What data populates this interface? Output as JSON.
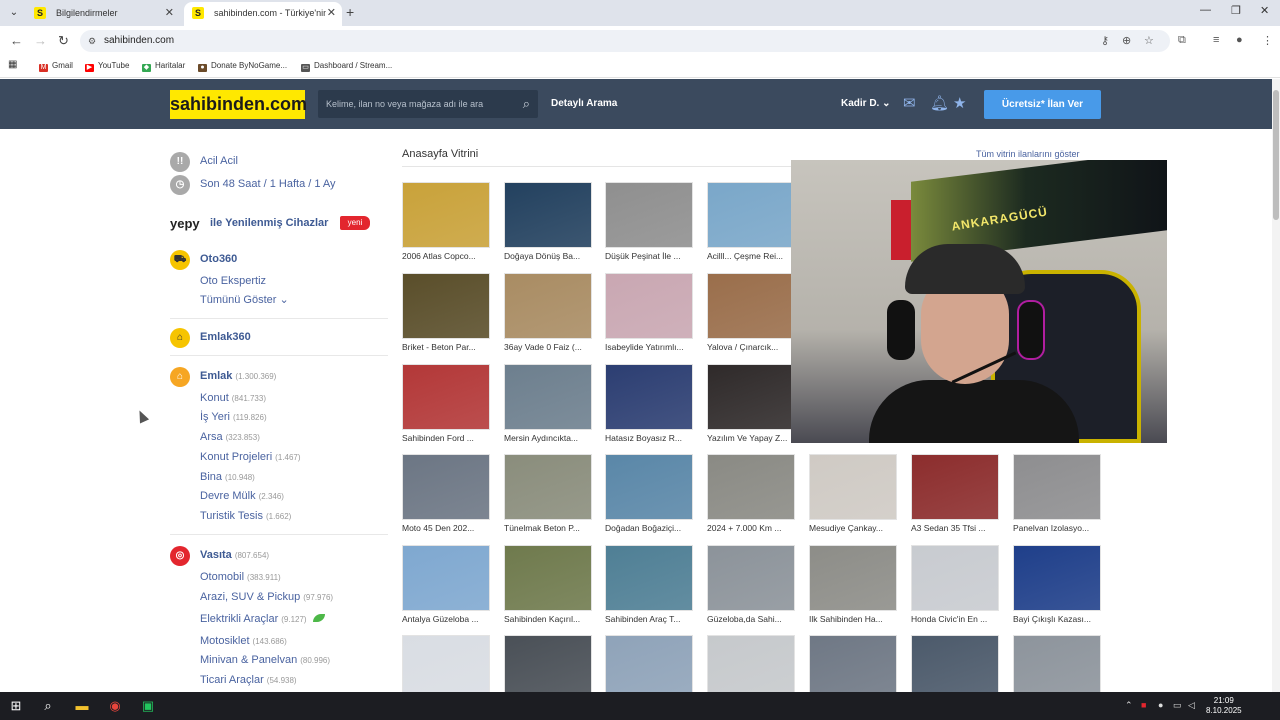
{
  "browser": {
    "tabs": [
      {
        "title": "Bilgilendirmeler",
        "favicon": "S"
      },
      {
        "title": "sahibinden.com - Türkiye'nin O",
        "favicon": "S"
      }
    ],
    "url": "sahibinden.com",
    "bookmarks": [
      "Gmail",
      "YouTube",
      "Haritalar",
      "Donate ByNoGame...",
      "Dashboard / Stream..."
    ]
  },
  "header": {
    "logo": "sahibinden.com",
    "search_placeholder": "Kelime, ilan no veya mağaza adı ile ara",
    "advanced_search": "Detaylı Arama",
    "user": "Kadir D.",
    "post_ad": "Ücretsiz* İlan Ver"
  },
  "sidebar": {
    "urgent": "Acil Acil",
    "recent": "Son 48 Saat / 1 Hafta / 1 Ay",
    "yepy_logo": "yepy",
    "yepy_text": "ile Yenilenmiş Cihazlar",
    "yepy_badge": "yeni",
    "oto360": "Oto360",
    "oto_ekspertiz": "Oto Ekspertiz",
    "show_all": "Tümünü Göster",
    "emlak360": "Emlak360",
    "emlak": {
      "label": "Emlak",
      "count": "(1.300.369)"
    },
    "emlak_items": [
      {
        "label": "Konut",
        "count": "(841.733)"
      },
      {
        "label": "İş Yeri",
        "count": "(119.826)"
      },
      {
        "label": "Arsa",
        "count": "(323.853)"
      },
      {
        "label": "Konut Projeleri",
        "count": "(1.467)"
      },
      {
        "label": "Bina",
        "count": "(10.948)"
      },
      {
        "label": "Devre Mülk",
        "count": "(2.346)"
      },
      {
        "label": "Turistik Tesis",
        "count": "(1.662)"
      }
    ],
    "vasita": {
      "label": "Vasıta",
      "count": "(807.654)"
    },
    "vasita_items": [
      {
        "label": "Otomobil",
        "count": "(383.911)"
      },
      {
        "label": "Arazi, SUV & Pickup",
        "count": "(97.976)"
      },
      {
        "label": "Elektrikli Araçlar",
        "count": "(9.127)"
      },
      {
        "label": "Motosiklet",
        "count": "(143.686)"
      },
      {
        "label": "Minivan & Panelvan",
        "count": "(80.996)"
      },
      {
        "label": "Ticari Araçlar",
        "count": "(54.938)"
      }
    ]
  },
  "showcase": {
    "title": "Anasayfa Vitrini",
    "show_all": "Tüm vitrin ilanlarını göster",
    "cards": [
      {
        "caption": "2006 Atlas Copco...",
        "color": "#c9a23a"
      },
      {
        "caption": "Doğaya Dönüş Ba...",
        "color": "#23415f"
      },
      {
        "caption": "Düşük Peşinat İle ...",
        "color": "#8f8f8f"
      },
      {
        "caption": "Acilll... Çeşme Rei...",
        "color": "#7aa7c9"
      },
      {
        "caption": "Briket - Beton Par...",
        "color": "#5a4e2a"
      },
      {
        "caption": "36ay Vade 0 Faiz (...",
        "color": "#a98c63"
      },
      {
        "caption": "Isabeylide Yatırımlı...",
        "color": "#c9a7b2"
      },
      {
        "caption": "Yalova / Çınarcık...",
        "color": "#9a6e4b"
      },
      {
        "caption": "Sahibinden Ford ...",
        "color": "#b33838"
      },
      {
        "caption": "Mersin Aydıncıkta...",
        "color": "#6d7f8e"
      },
      {
        "caption": "Hatasız Boyasız R...",
        "color": "#2c3e72"
      },
      {
        "caption": "Yazılım Ve Yapay Z...",
        "color": "#2f2a2a"
      },
      {
        "caption": "Moto 45 Den 202...",
        "color": "#6c7684"
      },
      {
        "caption": "Tünelmak Beton P...",
        "color": "#8a8d7c"
      },
      {
        "caption": "Doğadan Boğaziçi...",
        "color": "#5a87a8"
      },
      {
        "caption": "2024 + 7.000 Km ...",
        "color": "#8a8a84"
      },
      {
        "caption": "Mesudiye Çankay...",
        "color": "#cfcac4"
      },
      {
        "caption": "A3 Sedan 35 Tfsi ...",
        "color": "#8c2d2d"
      },
      {
        "caption": "Panelvan Izolasyo...",
        "color": "#8e8e90"
      },
      {
        "caption": "Antalya Güzeloba ...",
        "color": "#7fa8d0"
      },
      {
        "caption": "Sahibinden Kaçırıl...",
        "color": "#6f7a4d"
      },
      {
        "caption": "Sahibinden Araç T...",
        "color": "#4f7f95"
      },
      {
        "caption": "Güzeloba,da Sahi...",
        "color": "#8c939a"
      },
      {
        "caption": "Ilk Sahibinden Ha...",
        "color": "#8d8d88"
      },
      {
        "caption": "Honda Civic'in En ...",
        "color": "#c8cbd0"
      },
      {
        "caption": "Bayi Çıkışlı Kazası...",
        "color": "#1f3f8a"
      },
      {
        "caption": "",
        "color": "#d9dde3"
      },
      {
        "caption": "",
        "color": "#4a5057"
      },
      {
        "caption": "",
        "color": "#8fa3b9"
      },
      {
        "caption": "",
        "color": "#c6c9cc"
      },
      {
        "caption": "",
        "color": "#6f7885"
      },
      {
        "caption": "",
        "color": "#4c5a6b"
      },
      {
        "caption": "",
        "color": "#8d949c"
      }
    ]
  },
  "webcam": {
    "banner_text": "ANKARAGÜCÜ"
  },
  "taskbar": {
    "time": "21:09",
    "date": "8.10.2025"
  }
}
